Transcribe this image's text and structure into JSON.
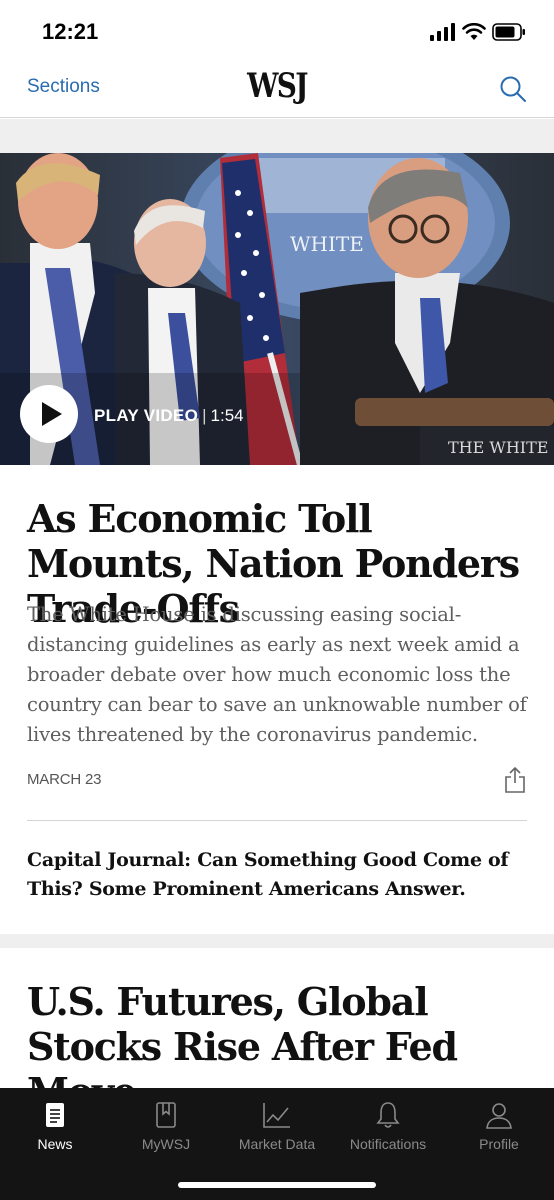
{
  "status_bar": {
    "time": "12:21"
  },
  "nav": {
    "sections_label": "Sections",
    "logo": "WSJ",
    "search_icon": "search-icon"
  },
  "hero": {
    "play_label": "PLAY VIDEO",
    "duration": "1:54",
    "backdrop_text": "WHITE",
    "podium_text": "THE WHITE"
  },
  "article_1": {
    "headline": "As Economic Toll Mounts, Nation Ponders Trade-Offs",
    "summary": "The White House is discussing easing social-distancing guidelines as early as next week amid a broader debate over how much economic loss the country can bear to save an unknowable number of lives threatened by the coronavirus pandemic.",
    "date": "MARCH 23",
    "related": "Capital Journal: Can Something Good Come of This? Some Prominent Americans Answer."
  },
  "article_2": {
    "headline": "U.S. Futures, Global Stocks Rise After Fed Move"
  },
  "tabs": [
    {
      "label": "News",
      "icon": "news-icon",
      "active": true
    },
    {
      "label": "MyWSJ",
      "icon": "bookmark-icon",
      "active": false
    },
    {
      "label": "Market Data",
      "icon": "chart-icon",
      "active": false
    },
    {
      "label": "Notifications",
      "icon": "bell-icon",
      "active": false
    },
    {
      "label": "Profile",
      "icon": "profile-icon",
      "active": false
    }
  ],
  "colors": {
    "accent": "#2a6cb0",
    "tab_bar": "#141414",
    "summary_text": "#5e5e5e"
  }
}
